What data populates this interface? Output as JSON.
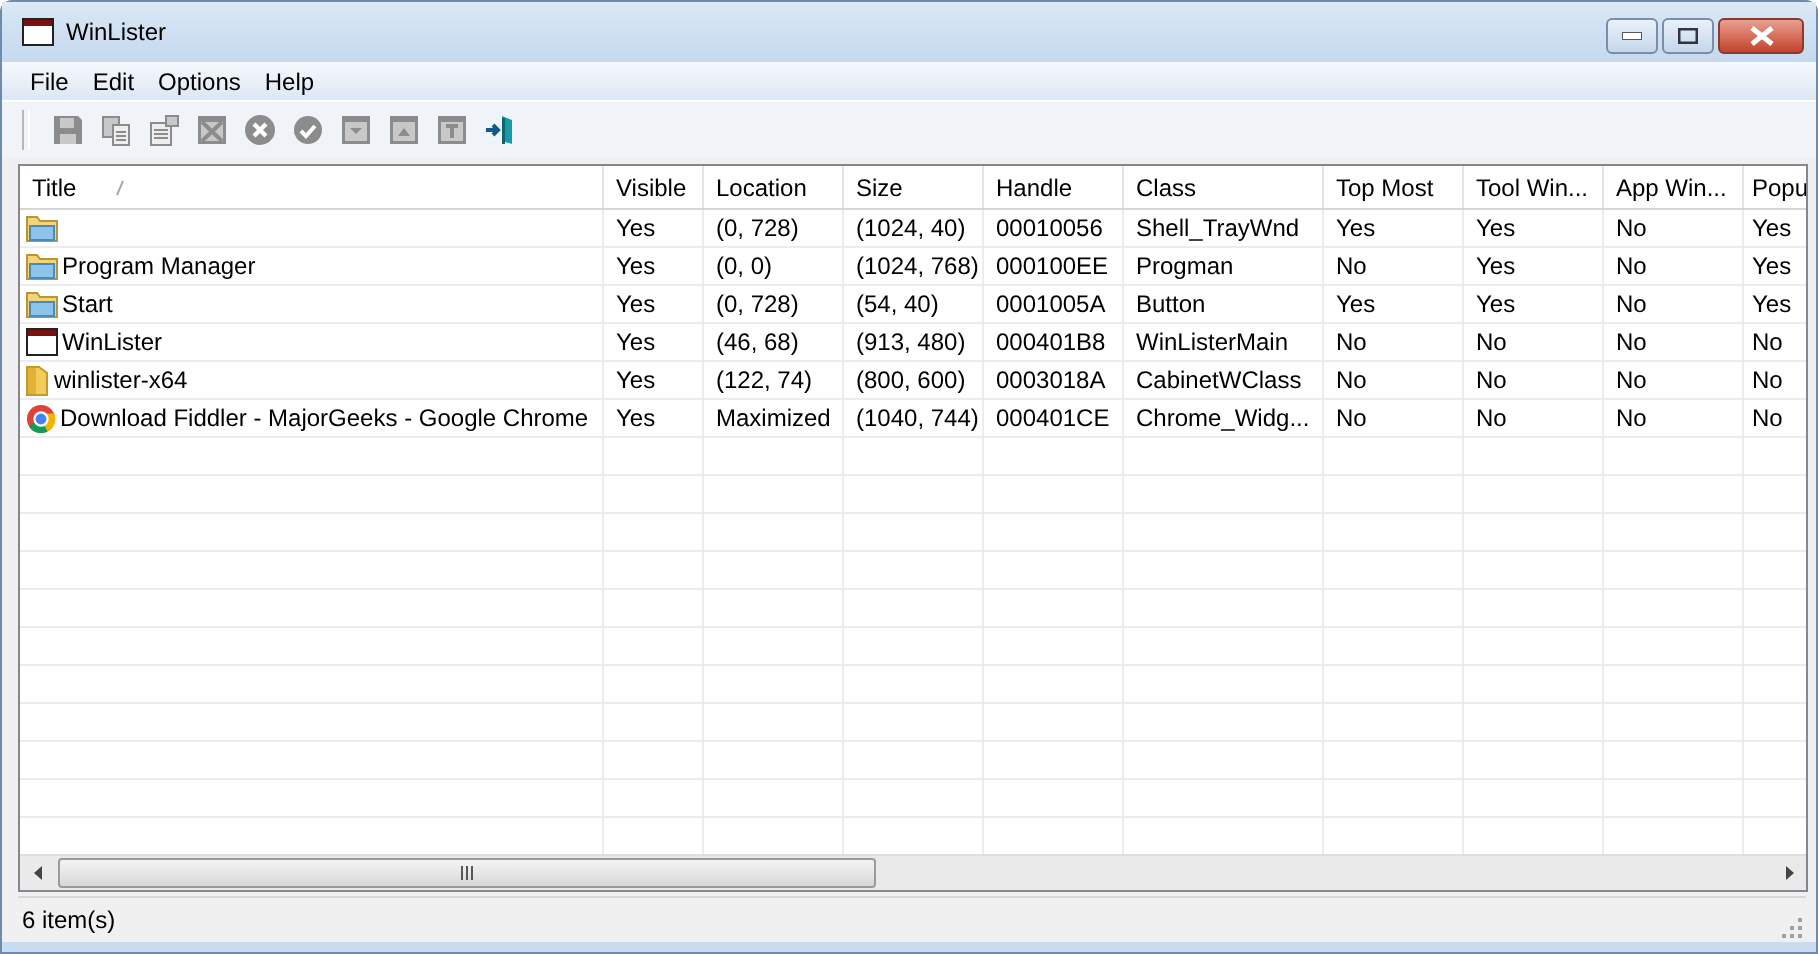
{
  "window": {
    "title": "WinLister"
  },
  "menu": [
    "File",
    "Edit",
    "Options",
    "Help"
  ],
  "toolbar": [
    {
      "kind": "save",
      "disabled": true
    },
    {
      "kind": "copy",
      "disabled": true
    },
    {
      "kind": "properties",
      "disabled": true
    },
    {
      "kind": "close-window",
      "disabled": true
    },
    {
      "kind": "stop",
      "disabled": true
    },
    {
      "kind": "check",
      "disabled": true
    },
    {
      "kind": "minimize-window",
      "disabled": true
    },
    {
      "kind": "maximize-window",
      "disabled": true
    },
    {
      "kind": "restore-window",
      "disabled": true
    },
    {
      "kind": "exit",
      "disabled": false
    }
  ],
  "table": {
    "columns": [
      {
        "label": "Title",
        "sorted": true
      },
      {
        "label": "Visible",
        "sorted": false
      },
      {
        "label": "Location",
        "sorted": false
      },
      {
        "label": "Size",
        "sorted": false
      },
      {
        "label": "Handle",
        "sorted": false
      },
      {
        "label": "Class",
        "sorted": false
      },
      {
        "label": "Top Most",
        "sorted": false
      },
      {
        "label": "Tool Win...",
        "sorted": false
      },
      {
        "label": "App Win...",
        "sorted": false
      },
      {
        "label": "Popu",
        "sorted": false
      }
    ],
    "rows": [
      {
        "kind": "app-folder",
        "cells": [
          "",
          "Yes",
          "(0, 728)",
          "(1024, 40)",
          "00010056",
          "Shell_TrayWnd",
          "Yes",
          "Yes",
          "No",
          "Yes"
        ]
      },
      {
        "kind": "app-folder",
        "cells": [
          "Program Manager",
          "Yes",
          "(0, 0)",
          "(1024, 768)",
          "000100EE",
          "Progman",
          "No",
          "Yes",
          "No",
          "Yes"
        ]
      },
      {
        "kind": "app-folder",
        "cells": [
          "Start",
          "Yes",
          "(0, 728)",
          "(54, 40)",
          "0001005A",
          "Button",
          "Yes",
          "Yes",
          "No",
          "Yes"
        ]
      },
      {
        "kind": "window",
        "cells": [
          "WinLister",
          "Yes",
          "(46, 68)",
          "(913, 480)",
          "000401B8",
          "WinListerMain",
          "No",
          "No",
          "No",
          "No"
        ]
      },
      {
        "kind": "folder",
        "cells": [
          "winlister-x64",
          "Yes",
          "(122, 74)",
          "(800, 600)",
          "0003018A",
          "CabinetWClass",
          "No",
          "No",
          "No",
          "No"
        ]
      },
      {
        "kind": "browser",
        "cells": [
          "Download Fiddler - MajorGeeks - Google Chrome",
          "Yes",
          "Maximized",
          "(1040, 744)",
          "000401CE",
          "Chrome_Widg...",
          "No",
          "No",
          "No",
          "No"
        ]
      }
    ]
  },
  "status_bar": "6 item(s)"
}
